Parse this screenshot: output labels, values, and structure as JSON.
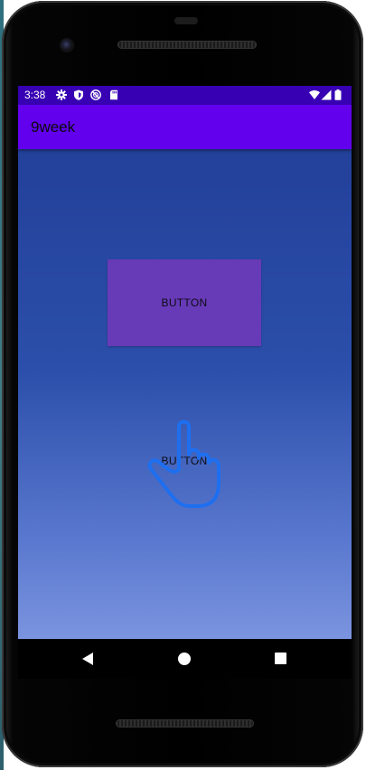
{
  "status_bar": {
    "time": "3:38",
    "icons": [
      "settings-icon",
      "shield-icon",
      "sync-blocked-icon",
      "sd-card-icon",
      "wifi-icon",
      "signal-icon",
      "battery-icon"
    ]
  },
  "app_bar": {
    "title": "9week"
  },
  "content": {
    "button_1_label": "BUTTON",
    "button_2_label": "BUTTON",
    "overlay_icon": "tap-hand-icon"
  },
  "nav_bar": {
    "icons": [
      "back-icon",
      "home-icon",
      "recents-icon"
    ]
  },
  "colors": {
    "status_bar": "#3700b3",
    "app_bar": "#6200ee",
    "button": "#673ab7",
    "background_top": "#23409a",
    "background_bottom": "#7b94df",
    "tap_hand": "#1e6ff0"
  }
}
